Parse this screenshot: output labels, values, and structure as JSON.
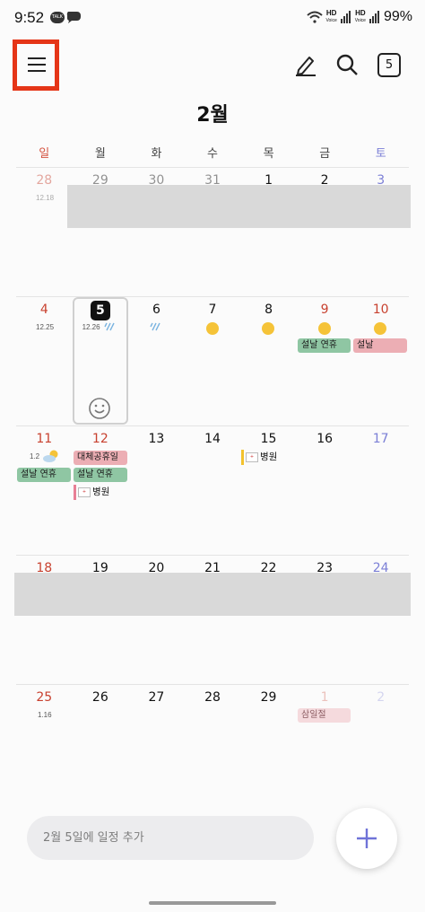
{
  "status": {
    "time": "9:52",
    "talk_badge": "TALK",
    "hd1": "HD",
    "hd2": "HD",
    "voice": "Voice",
    "battery": "99%"
  },
  "toolbar": {
    "today_badge": "5"
  },
  "header": {
    "title": "2월"
  },
  "weekdays": [
    "일",
    "월",
    "화",
    "수",
    "목",
    "금",
    "토"
  ],
  "weeks": [
    {
      "days": [
        "28",
        "29",
        "30",
        "31",
        "1",
        "2",
        "3"
      ],
      "lunar": "12.18"
    },
    {
      "days": [
        "4",
        "5",
        "6",
        "7",
        "8",
        "9",
        "10"
      ],
      "lunar_sun": "12.25",
      "lunar_mon": "12.26",
      "events": {
        "seol1": "설날 연휴",
        "seol2": "설날"
      }
    },
    {
      "days": [
        "11",
        "12",
        "13",
        "14",
        "15",
        "16",
        "17"
      ],
      "lunar": "1.2",
      "events": {
        "daechae": "대체공휴일",
        "seol3": "설날 연휴",
        "seol4": "설날 연휴",
        "hosp1": "병원",
        "hosp2": "병원"
      }
    },
    {
      "days": [
        "18",
        "19",
        "20",
        "21",
        "22",
        "23",
        "24"
      ]
    },
    {
      "days": [
        "25",
        "26",
        "27",
        "28",
        "29",
        "1",
        "2"
      ],
      "lunar": "1.16",
      "events": {
        "samil": "삼일절"
      }
    }
  ],
  "bottom": {
    "add_placeholder": "2월 5일에 일정 추가"
  },
  "colors": {
    "highlight": "#e53517",
    "holiday_green": "#8fc6a3",
    "holiday_pink": "#ecaeb4",
    "sunday": "#c8412f",
    "saturday": "#7b7fd6"
  }
}
